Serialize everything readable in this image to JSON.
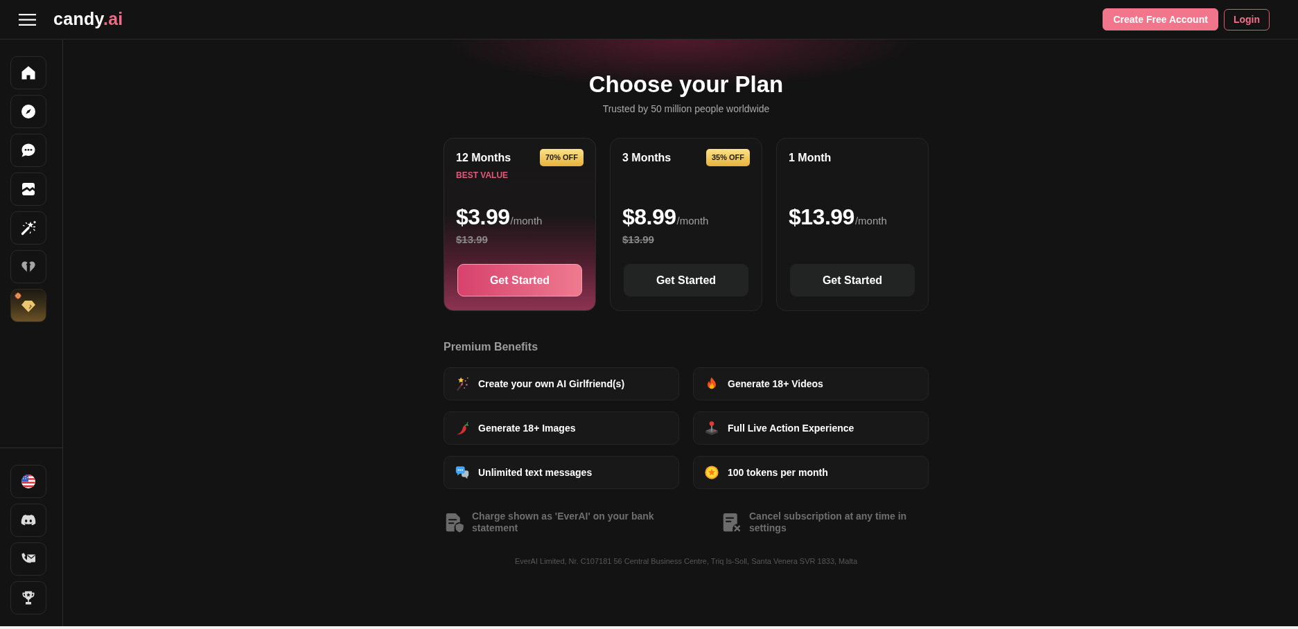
{
  "header": {
    "logo": {
      "name": "candy",
      "suffix": ".ai"
    },
    "buttons": [
      {
        "label": "Create Free Account",
        "kind": "primary"
      },
      {
        "label": "Login",
        "kind": "outline"
      }
    ]
  },
  "sidebar": {
    "top_items": [
      {
        "selected": false
      },
      {
        "selected": false
      },
      {
        "selected": false
      },
      {
        "selected": false
      },
      {
        "selected": false
      },
      {
        "selected": false
      },
      {
        "selected": true
      }
    ],
    "bottom_items": [
      {
        "selected": false
      },
      {
        "selected": false
      },
      {
        "selected": false
      },
      {
        "selected": false
      }
    ]
  },
  "page": {
    "title": "Choose your Plan",
    "subtitle": "Trusted by 50 million people worldwide"
  },
  "plans": [
    {
      "duration": "12 Months",
      "discount": "70% OFF",
      "highlight": "BEST VALUE",
      "price": "$3.99",
      "period": "/month",
      "original_price": "$13.99",
      "button": "Get Started",
      "selected": true
    },
    {
      "duration": "3 Months",
      "discount": "35% OFF",
      "price": "$8.99",
      "period": "/month",
      "original_price": "$13.99",
      "button": "Get Started",
      "selected": false
    },
    {
      "duration": "1 Month",
      "price": "$13.99",
      "period": "/month",
      "button": "Get Started",
      "selected": false
    }
  ],
  "benefits": {
    "title": "Premium Benefits",
    "items": [
      "Create your own AI Girlfriend(s)",
      "Generate 18+ Videos",
      "Generate 18+ Images",
      "Full Live Action Experience",
      "Unlimited text messages",
      "100 tokens per month"
    ]
  },
  "notes": [
    "Charge shown as 'EverAI' on your bank statement",
    "Cancel subscription at any time in settings"
  ],
  "footer": {
    "address": "EverAI Limited, Nr. C107181 56 Central Business Centre, Triq Is-Soll, Santa Venera SVR 1833, Malta"
  }
}
